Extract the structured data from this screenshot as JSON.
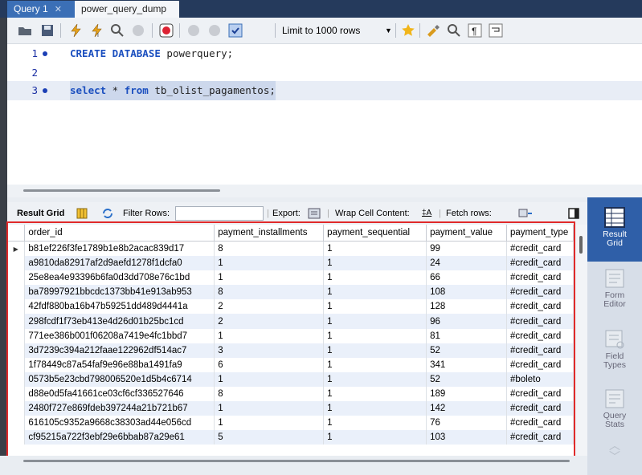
{
  "tabs": [
    {
      "label": "Query 1",
      "active": true
    },
    {
      "label": "power_query_dump",
      "active": false
    }
  ],
  "toolbar": {
    "limit_label": "Limit to 1000 rows"
  },
  "editor": {
    "lines": [
      {
        "num": "1",
        "tokens": [
          {
            "t": "CREATE DATABASE",
            "k": "kw"
          },
          {
            "t": " powerquery;",
            "k": "id"
          }
        ]
      },
      {
        "num": "2",
        "tokens": []
      },
      {
        "num": "3",
        "tokens": [
          {
            "t": "select",
            "k": "kw"
          },
          {
            "t": " * ",
            "k": "id"
          },
          {
            "t": "from",
            "k": "kw"
          },
          {
            "t": " tb_olist_pagamentos;",
            "k": "id"
          }
        ]
      }
    ]
  },
  "result_toolbar": {
    "result_grid": "Result Grid",
    "filter_rows": "Filter Rows:",
    "export": "Export:",
    "wrap": "Wrap Cell Content:",
    "fetch": "Fetch rows:"
  },
  "right_panel": [
    {
      "label": "Result\nGrid",
      "active": true,
      "icon": "result-grid-icon"
    },
    {
      "label": "Form\nEditor",
      "active": false,
      "icon": "form-editor-icon"
    },
    {
      "label": "Field\nTypes",
      "active": false,
      "icon": "field-types-icon"
    },
    {
      "label": "Query\nStats",
      "active": false,
      "icon": "query-stats-icon"
    }
  ],
  "grid": {
    "columns": [
      "order_id",
      "payment_installments",
      "payment_sequential",
      "payment_value",
      "payment_type"
    ],
    "rows": [
      [
        "b81ef226f3fe1789b1e8b2acac839d17",
        "8",
        "1",
        "99",
        "#credit_card"
      ],
      [
        "a9810da82917af2d9aefd1278f1dcfa0",
        "1",
        "1",
        "24",
        "#credit_card"
      ],
      [
        "25e8ea4e93396b6fa0d3dd708e76c1bd",
        "1",
        "1",
        "66",
        "#credit_card"
      ],
      [
        "ba78997921bbcdc1373bb41e913ab953",
        "8",
        "1",
        "108",
        "#credit_card"
      ],
      [
        "42fdf880ba16b47b59251dd489d4441a",
        "2",
        "1",
        "128",
        "#credit_card"
      ],
      [
        "298fcdf1f73eb413e4d26d01b25bc1cd",
        "2",
        "1",
        "96",
        "#credit_card"
      ],
      [
        "771ee386b001f06208a7419e4fc1bbd7",
        "1",
        "1",
        "81",
        "#credit_card"
      ],
      [
        "3d7239c394a212faae122962df514ac7",
        "3",
        "1",
        "52",
        "#credit_card"
      ],
      [
        "1f78449c87a54faf9e96e88ba1491fa9",
        "6",
        "1",
        "341",
        "#credit_card"
      ],
      [
        "0573b5e23cbd798006520e1d5b4c6714",
        "1",
        "1",
        "52",
        "#boleto"
      ],
      [
        "d88e0d5fa41661ce03cf6cf336527646",
        "8",
        "1",
        "189",
        "#credit_card"
      ],
      [
        "2480f727e869fdeb397244a21b721b67",
        "1",
        "1",
        "142",
        "#credit_card"
      ],
      [
        "616105c9352a9668c38303ad44e056cd",
        "1",
        "1",
        "76",
        "#credit_card"
      ],
      [
        "cf95215a722f3ebf29e6bbab87a29e61",
        "5",
        "1",
        "103",
        "#credit_card"
      ]
    ]
  },
  "colors": {
    "accent": "#2f5fa8",
    "highlight_box": "#e02a2a"
  }
}
